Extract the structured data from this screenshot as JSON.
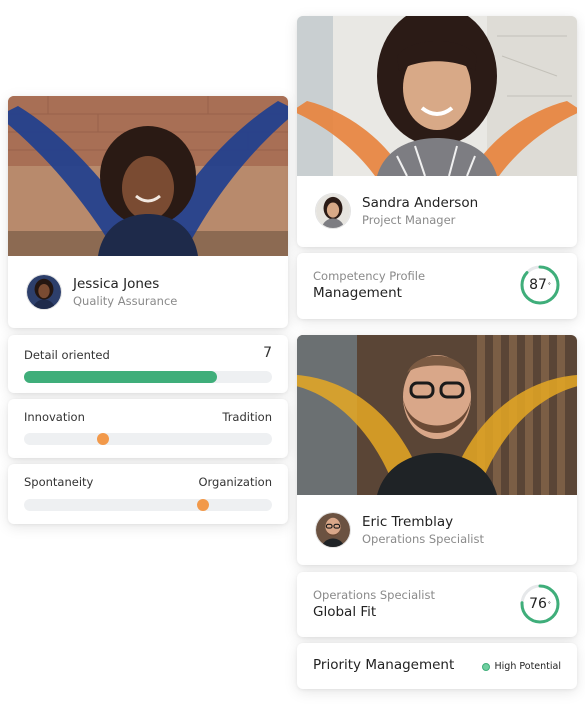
{
  "jessica": {
    "name": "Jessica Jones",
    "role": "Quality Assurance"
  },
  "sandra": {
    "name": "Sandra Anderson",
    "role": "Project Manager"
  },
  "eric": {
    "name": "Eric Tremblay",
    "role": "Operations Specialist"
  },
  "traits": {
    "detail": {
      "label": "Detail oriented",
      "value": "7",
      "level": 0.78
    },
    "innovation": {
      "left": "Innovation",
      "right": "Tradition",
      "position": 0.32
    },
    "spontaneity": {
      "left": "Spontaneity",
      "right": "Organization",
      "position": 0.72
    }
  },
  "competency": {
    "subtitle": "Competency Profile",
    "title": "Management",
    "score": "87",
    "fraction": 0.87
  },
  "globalfit": {
    "subtitle": "Operations Specialist",
    "title": "Global Fit",
    "score": "76",
    "fraction": 0.76
  },
  "priority": {
    "label": "Priority Management",
    "badge": "High Potential"
  },
  "colors": {
    "accent_green": "#3fae7a",
    "accent_orange": "#f2994a",
    "overlay_blue": "#1f3f8f",
    "overlay_orange": "#e8823b",
    "overlay_yellow": "#e6a823"
  }
}
